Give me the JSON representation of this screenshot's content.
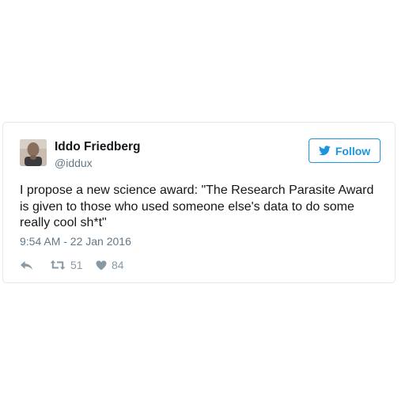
{
  "tweet": {
    "author": {
      "name": "Iddo Friedberg",
      "handle": "@iddux"
    },
    "follow_label": "Follow",
    "text": "I propose a new science award: \"The Research Parasite Award is given to those who used someone else's data to do some really cool sh*t\"",
    "timestamp": "9:54 AM - 22 Jan 2016",
    "actions": {
      "reply_icon": "reply-icon",
      "retweet_icon": "retweet-icon",
      "retweet_count": "51",
      "like_icon": "heart-icon",
      "like_count": "84"
    }
  },
  "colors": {
    "accent": "#1b95e0",
    "text": "#14171a",
    "muted": "#657786",
    "action": "#8899a6",
    "border": "#e1e8ed"
  }
}
